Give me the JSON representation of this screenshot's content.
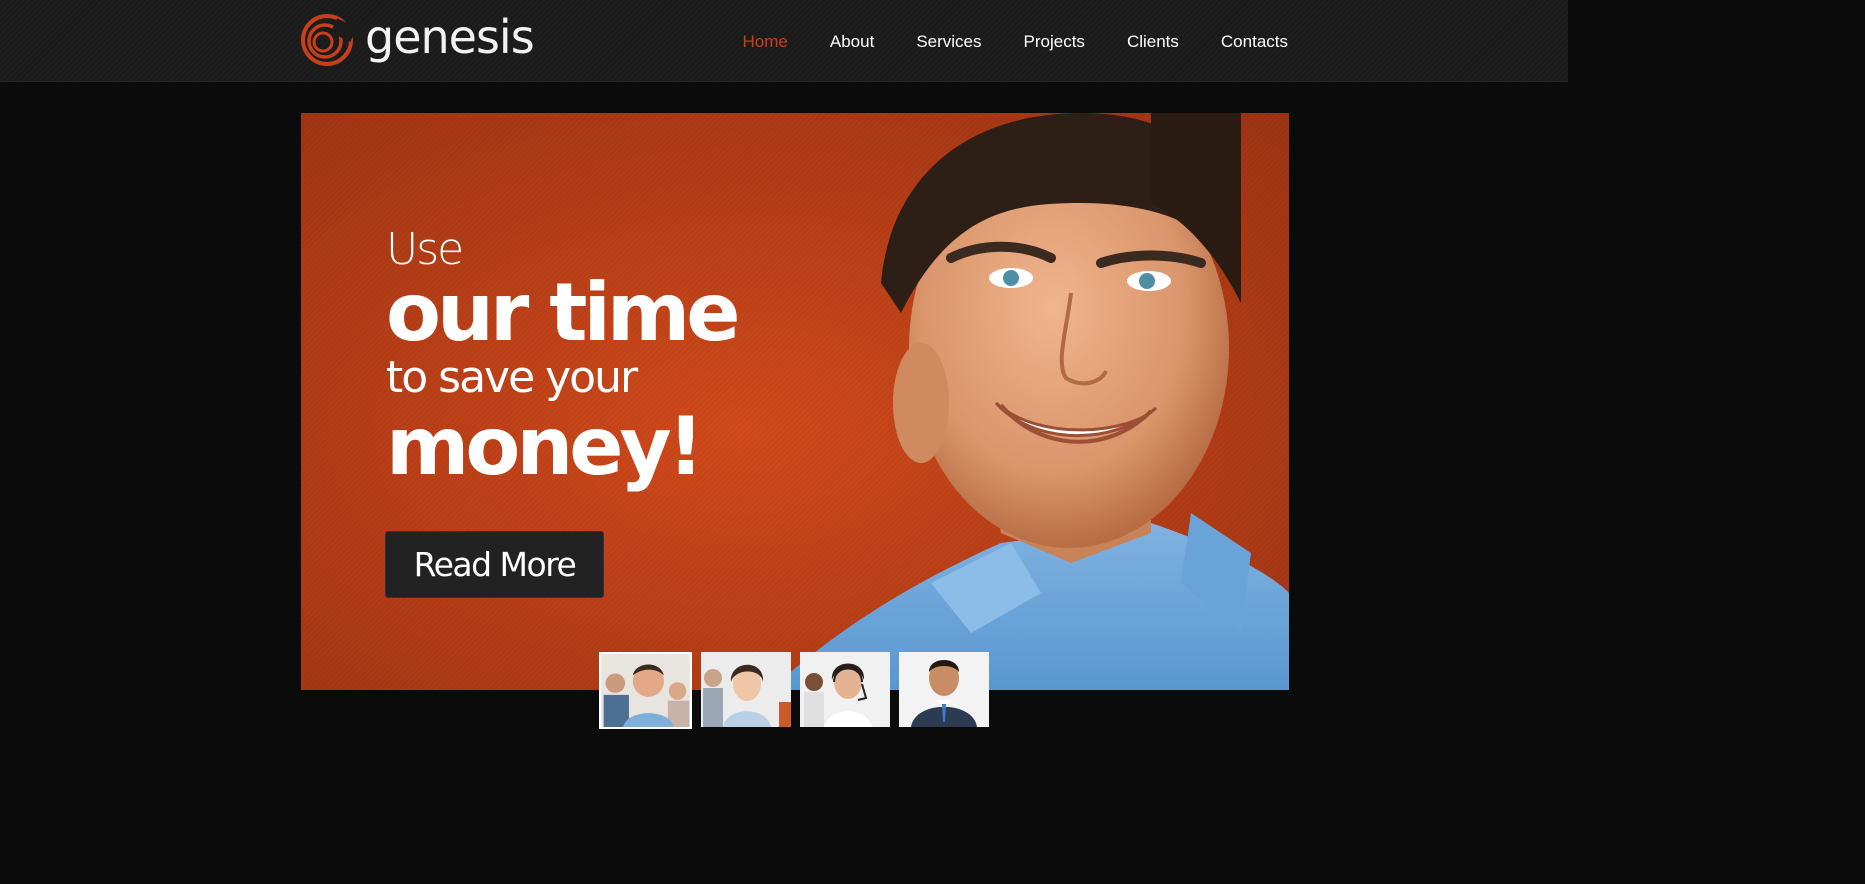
{
  "brand": {
    "name": "genesis",
    "accent": "#c8401b",
    "logo_icon": "swirl-logo-icon"
  },
  "nav": {
    "items": [
      {
        "label": "Home",
        "active": true
      },
      {
        "label": "About",
        "active": false
      },
      {
        "label": "Services",
        "active": false
      },
      {
        "label": "Projects",
        "active": false
      },
      {
        "label": "Clients",
        "active": false
      },
      {
        "label": "Contacts",
        "active": false
      }
    ]
  },
  "hero": {
    "line1": "Use",
    "line2": "our time",
    "line3": "to save your",
    "line4": "money!",
    "cta_label": "Read More",
    "background": "#c4441a"
  },
  "thumbnails": {
    "count": 4,
    "selected_index": 0,
    "items": [
      "thumb-group-photo",
      "thumb-woman-smiling",
      "thumb-headset-operator",
      "thumb-businessman"
    ]
  }
}
